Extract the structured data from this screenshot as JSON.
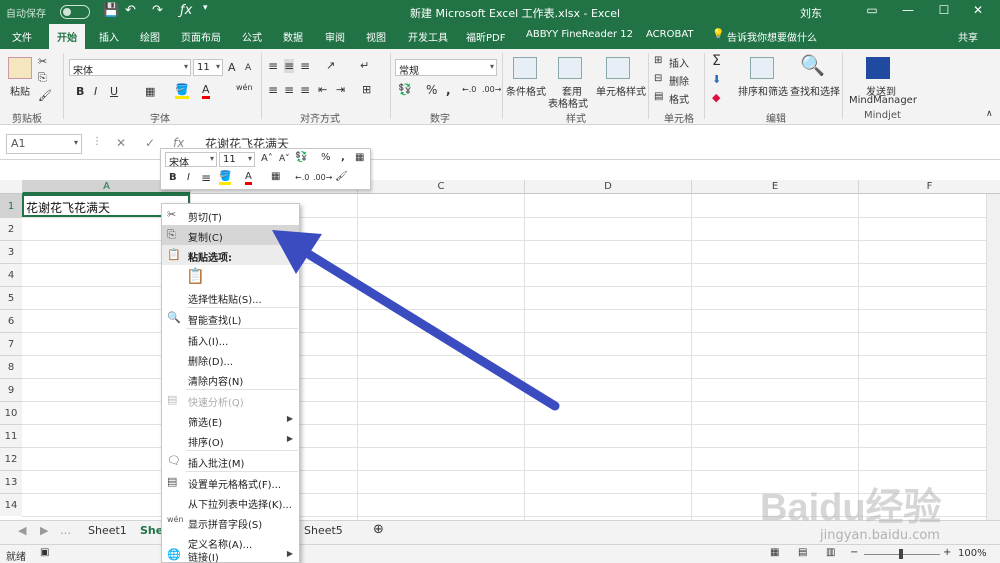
{
  "titlebar": {
    "autosave": "自动保存",
    "autosave_state": "关",
    "title": "新建 Microsoft Excel 工作表.xlsx  -  Excel",
    "user": "刘东"
  },
  "tabs": [
    "文件",
    "开始",
    "插入",
    "绘图",
    "页面布局",
    "公式",
    "数据",
    "审阅",
    "视图",
    "开发工具",
    "福昕PDF",
    "ABBYY FineReader 12",
    "ACROBAT",
    "告诉我你想要做什么",
    "共享"
  ],
  "ribbon": {
    "clipboard": {
      "paste": "粘贴",
      "label": "剪贴板"
    },
    "font": {
      "name": "宋体",
      "size": "11",
      "label": "字体",
      "bold": "B",
      "italic": "I",
      "underline": "U",
      "grow": "A",
      "shrink": "A",
      "wen": "wén"
    },
    "align": {
      "label": "对齐方式"
    },
    "number": {
      "format": "常规",
      "label": "数字",
      "percent": "%",
      "comma": ","
    },
    "styles": {
      "cond": "条件格式",
      "table1": "套用",
      "table2": "表格格式",
      "cell": "单元格样式",
      "label": "样式"
    },
    "cells": {
      "insert": "插入",
      "delete": "删除",
      "format": "格式",
      "label": "单元格"
    },
    "editing": {
      "sort": "排序和筛选",
      "find": "查找和选择",
      "label": "编辑",
      "sum": "Σ"
    },
    "mindjet": {
      "send1": "发送到",
      "send2": "MindManager",
      "label": "Mindjet"
    }
  },
  "formulabar": {
    "namebox": "A1",
    "fx": "fx",
    "content": "花谢花飞花满天"
  },
  "grid": {
    "columns": [
      "A",
      "B",
      "C",
      "D",
      "E",
      "F"
    ],
    "rows": [
      "1",
      "2",
      "3",
      "4",
      "5",
      "6",
      "7",
      "8",
      "9",
      "10",
      "11",
      "12",
      "13",
      "14"
    ],
    "A1": "花谢花飞花满天"
  },
  "minibar": {
    "font": "宋体",
    "size": "11",
    "bold": "B",
    "italic": "I",
    "percent": "%",
    "comma": ","
  },
  "context_menu": {
    "items": [
      {
        "label": "剪切(T)",
        "icon": "scissors-icon"
      },
      {
        "label": "复制(C)",
        "icon": "copy-icon"
      },
      {
        "label": "粘贴选项:",
        "icon": "paste-icon"
      },
      {
        "label": "",
        "icon": "paste-keep-icon"
      },
      {
        "label": "选择性粘贴(S)...",
        "icon": ""
      },
      {
        "label": "智能查找(L)",
        "icon": "smart-lookup-icon"
      },
      {
        "label": "插入(I)...",
        "icon": ""
      },
      {
        "label": "删除(D)...",
        "icon": ""
      },
      {
        "label": "清除内容(N)",
        "icon": ""
      },
      {
        "label": "快速分析(Q)",
        "icon": "quick-analysis-icon"
      },
      {
        "label": "筛选(E)",
        "icon": ""
      },
      {
        "label": "排序(O)",
        "icon": ""
      },
      {
        "label": "插入批注(M)",
        "icon": "comment-icon"
      },
      {
        "label": "设置单元格格式(F)...",
        "icon": "format-cells-icon"
      },
      {
        "label": "从下拉列表中选择(K)...",
        "icon": ""
      },
      {
        "label": "显示拼音字段(S)",
        "icon": "phonetic-icon"
      },
      {
        "label": "定义名称(A)...",
        "icon": ""
      },
      {
        "label": "链接(I)",
        "icon": "link-icon"
      }
    ]
  },
  "sheets": [
    "Sheet1",
    "Sheet2",
    "Sheet5"
  ],
  "status": {
    "ready": "就绪",
    "zoom": "100%"
  },
  "watermark": {
    "brand": "Baidu经验",
    "url": "jingyan.baidu.com"
  },
  "colors": {
    "excel_green": "#217346",
    "arrow": "#3b4cc0"
  }
}
